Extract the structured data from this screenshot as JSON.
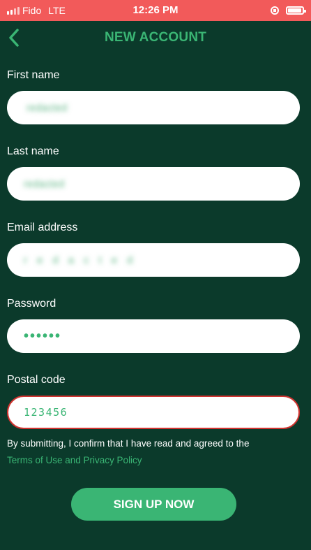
{
  "status_bar": {
    "carrier": "Fido",
    "network": "LTE",
    "time": "12:26 PM"
  },
  "header": {
    "title": "NEW ACCOUNT"
  },
  "form": {
    "first_name": {
      "label": "First name",
      "value": "redacted"
    },
    "last_name": {
      "label": "Last name",
      "value": "redacted"
    },
    "email": {
      "label": "Email address",
      "value": "redacted"
    },
    "password": {
      "label": "Password",
      "value": "••••••"
    },
    "postal_code": {
      "label": "Postal code",
      "value": "123456"
    }
  },
  "disclaimer": {
    "text": "By submitting, I confirm that I have read and agreed to the",
    "link": "Terms of Use and Privacy Policy"
  },
  "signup_button": {
    "label": "SIGN UP NOW"
  },
  "colors": {
    "background": "#0b3a2b",
    "accent": "#3ab574",
    "status_bar": "#f25a5a",
    "error_border": "#d0332f"
  },
  "icons": {
    "back": "chevron-left-icon",
    "signal": "signal-icon",
    "orientation_lock": "orientation-lock-icon",
    "battery": "battery-icon"
  }
}
